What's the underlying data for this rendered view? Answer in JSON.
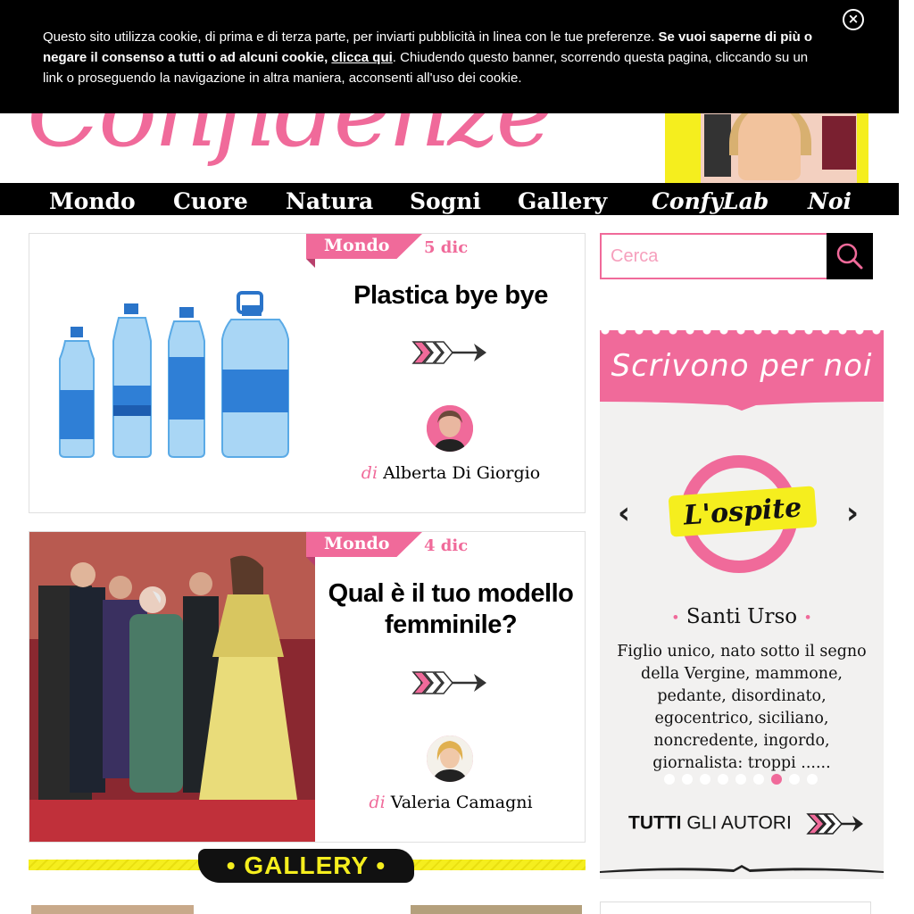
{
  "site": {
    "logo_text": "Confidenze"
  },
  "cookie": {
    "text_1": "Questo sito utilizza cookie, di prima e di terza parte, per inviarti pubblicità in linea con le tue preferenze. ",
    "bold_text": "Se vuoi saperne di più o negare il consenso a tutti o ad alcuni cookie, ",
    "link_text": "clicca qui",
    "text_2": ". Chiudendo questo banner, scorrendo questa pagina, cliccando su un link o proseguendo la navigazione in altra maniera, acconsenti all'uso dei cookie.",
    "close_label": "×"
  },
  "nav": {
    "items": [
      "Mondo",
      "Cuore",
      "Natura",
      "Sogni",
      "Gallery",
      "ConfyLab",
      "Noi"
    ]
  },
  "articles": [
    {
      "category": "Mondo",
      "date": "5 dic",
      "title": "Plastica bye bye",
      "by_prefix": "di",
      "author": "Alberta Di Giorgio"
    },
    {
      "category": "Mondo",
      "date": "4 dic",
      "title": "Qual è il tuo modello femminile?",
      "by_prefix": "di",
      "author": "Valeria Camagni"
    }
  ],
  "gallery": {
    "label": "• GALLERY •"
  },
  "search": {
    "placeholder": "Cerca"
  },
  "writers": {
    "heading": "Scrivono per noi",
    "badge": "L'ospite",
    "name": "Santi Urso",
    "bullet": "•",
    "description": "Figlio unico, nato sotto il segno della Vergine, mammone, pedante, disordinato, egocentrico, siciliano, noncredente, ingordo, giornalista: troppi ......",
    "prev": "‹",
    "next": "›",
    "pages_total": 9,
    "page_active": 7,
    "all_bold": "TUTTI",
    "all_rest": " GLI AUTORI"
  },
  "colors": {
    "accent": "#f06a9a",
    "yellow": "#f5ee1e",
    "dark": "#000000"
  }
}
